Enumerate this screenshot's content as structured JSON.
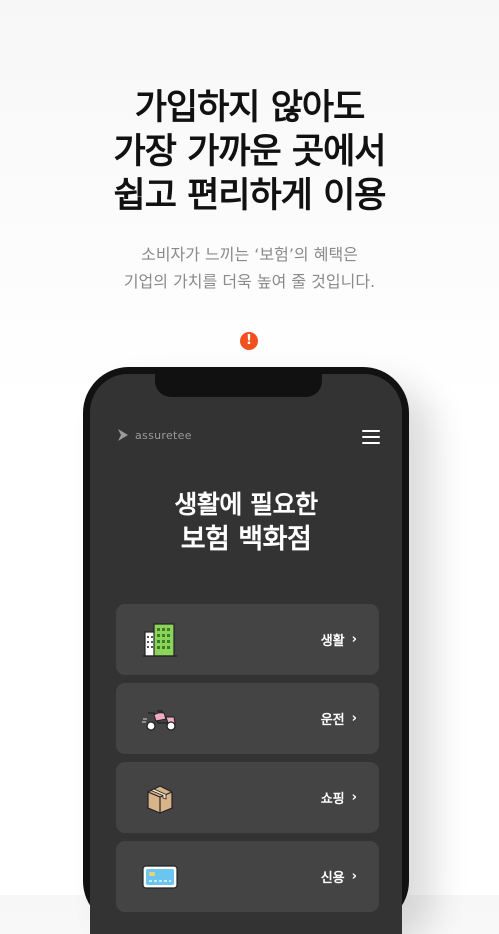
{
  "headline": {
    "line1": "가입하지 않아도",
    "line2": "가장 가까운 곳에서",
    "line3": "쉽고 편리하게 이용"
  },
  "subtext": {
    "line1": "소비자가 느끼는 ‘보험’의 혜택은",
    "line2": "기업의 가치를 더욱 높여 줄 것입니다."
  },
  "alert_badge": "!",
  "phone": {
    "brand": "assuretee",
    "hero": {
      "line1": "생활에 필요한",
      "line2": "보험 백화점"
    },
    "categories": [
      {
        "label": "생활",
        "icon": "building-icon"
      },
      {
        "label": "운전",
        "icon": "scooter-icon"
      },
      {
        "label": "쇼핑",
        "icon": "package-box-icon"
      },
      {
        "label": "신용",
        "icon": "credit-card-icon"
      }
    ],
    "chevron": "›"
  },
  "colors": {
    "accent": "#f0511f",
    "screen_bg": "#333333",
    "card_bg": "#444444"
  }
}
